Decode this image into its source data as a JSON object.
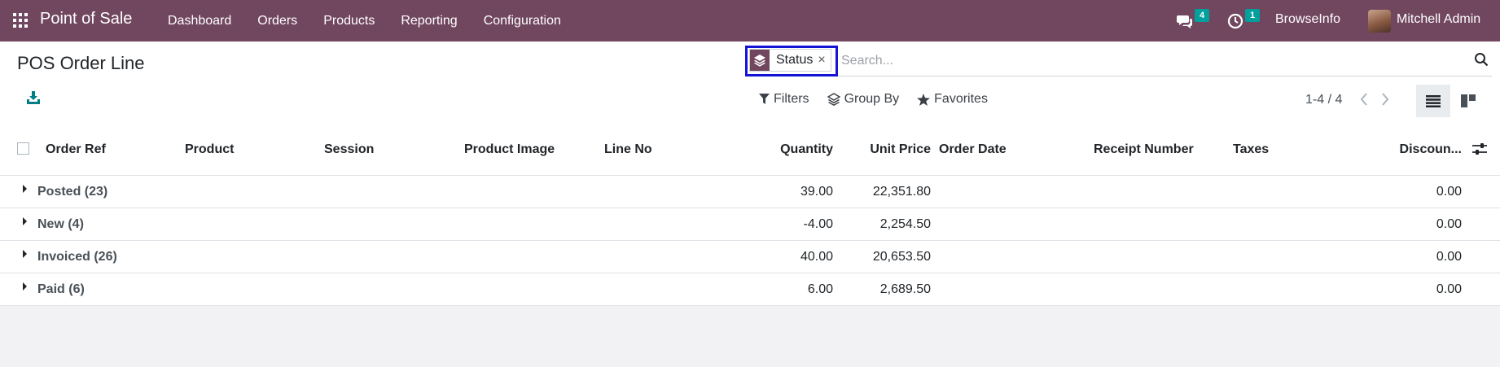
{
  "navbar": {
    "app_name": "Point of Sale",
    "menu": [
      "Dashboard",
      "Orders",
      "Products",
      "Reporting",
      "Configuration"
    ],
    "messages_count": "4",
    "activities_count": "1",
    "company": "BrowseInfo",
    "user": "Mitchell Admin",
    "color": "#71475f"
  },
  "control_panel": {
    "title": "POS Order Line",
    "search": {
      "facet_label": "Status",
      "facet_remove": "×",
      "placeholder": "Search..."
    },
    "filters_label": "Filters",
    "group_by_label": "Group By",
    "favorites_label": "Favorites",
    "pager": "1-4 / 4"
  },
  "list": {
    "columns": [
      "Order Ref",
      "Product",
      "Session",
      "Product Image",
      "Line No",
      "Quantity",
      "Unit Price",
      "Order Date",
      "Receipt Number",
      "Taxes",
      "Discoun..."
    ],
    "groups": [
      {
        "name": "Posted (23)",
        "quantity": "39.00",
        "unit_price": "22,351.80",
        "discount": "0.00"
      },
      {
        "name": "New (4)",
        "quantity": "-4.00",
        "unit_price": "2,254.50",
        "discount": "0.00"
      },
      {
        "name": "Invoiced (26)",
        "quantity": "40.00",
        "unit_price": "20,653.50",
        "discount": "0.00"
      },
      {
        "name": "Paid (6)",
        "quantity": "6.00",
        "unit_price": "2,689.50",
        "discount": "0.00"
      }
    ]
  }
}
